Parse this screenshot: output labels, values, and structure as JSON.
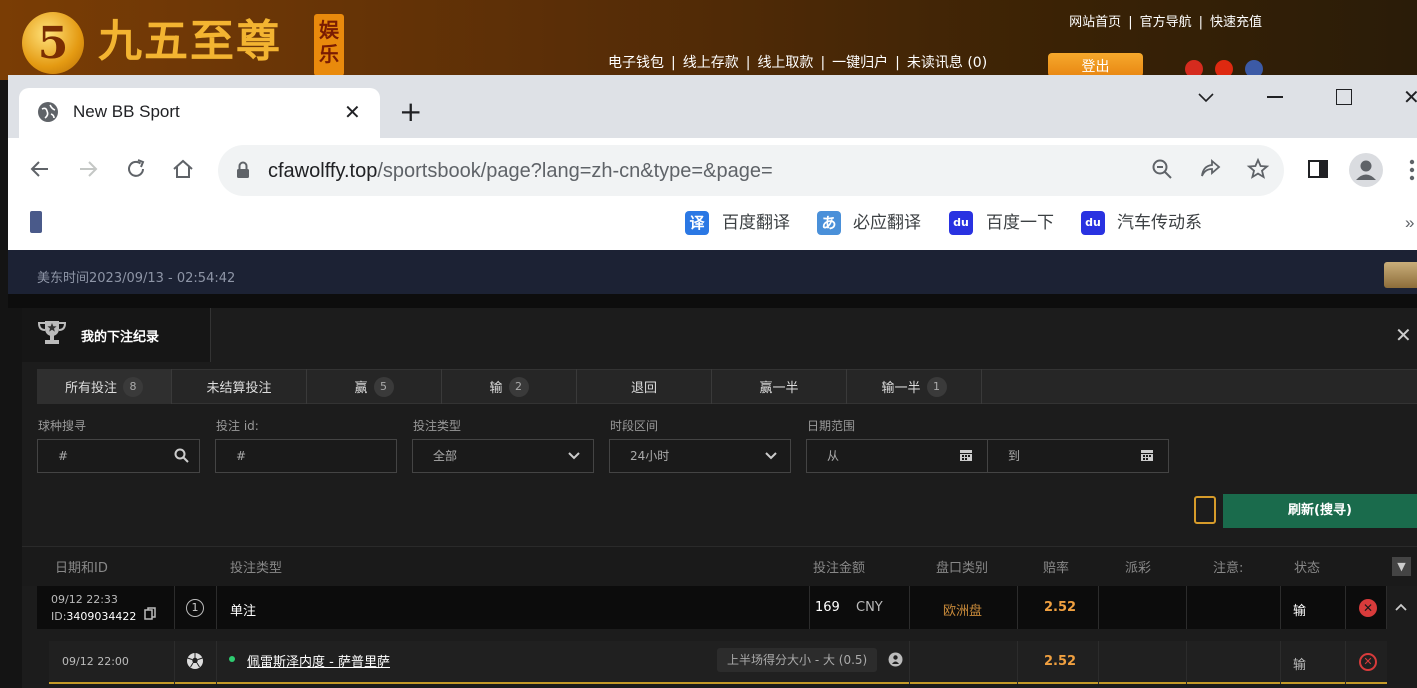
{
  "site": {
    "logo_mark": "5",
    "logo_text": "九五至尊",
    "logo_badge": "娱乐",
    "nav_top": [
      "网站首页",
      "官方导航",
      "快速充值"
    ],
    "nav_main": [
      "电子钱包",
      "线上存款",
      "线上取款",
      "一键归户",
      "未读讯息 (0)"
    ],
    "logout_label": "登出"
  },
  "browser": {
    "tab_title": "New BB Sport",
    "url_domain": "cfawolffy.top",
    "url_path": "/sportsbook/page?lang=zh-cn&type=&page=",
    "bookmarks": [
      {
        "icon": "译",
        "label": "百度翻译",
        "color": "#2b78e4"
      },
      {
        "icon": "あ",
        "label": "必应翻译",
        "color": "#4a90d9"
      },
      {
        "icon": "du",
        "label": "百度一下",
        "color": "#2932e1"
      },
      {
        "icon": "du",
        "label": "汽车传动系",
        "color": "#2932e1"
      }
    ],
    "bookmark_more": "»"
  },
  "sportsbook": {
    "time_label": "美东时间2023/09/13 - 02:54:42",
    "modal_title": "我的下注纪录",
    "tabs": [
      {
        "label": "所有投注",
        "count": "8"
      },
      {
        "label": "未结算投注",
        "count": ""
      },
      {
        "label": "赢",
        "count": "5"
      },
      {
        "label": "输",
        "count": "2"
      },
      {
        "label": "退回",
        "count": ""
      },
      {
        "label": "赢一半",
        "count": ""
      },
      {
        "label": "输一半",
        "count": "1"
      }
    ],
    "filters": {
      "sport_label": "球种搜寻",
      "sport_placeholder": "#",
      "betid_label": "投注 id:",
      "betid_placeholder": "#",
      "bettype_label": "投注类型",
      "bettype_value": "全部",
      "period_label": "时段区间",
      "period_value": "24小时",
      "date_label": "日期范围",
      "date_from": "从",
      "date_to": "到"
    },
    "refresh_label": "刷新(搜寻)",
    "columns": [
      "日期和ID",
      "投注类型",
      "投注金额",
      "盘口类别",
      "赔率",
      "派彩",
      "注意:",
      "状态"
    ],
    "bet": {
      "date": "09/12 22:33",
      "id_prefix": "ID:",
      "id": "3409034422",
      "leg_count": "1",
      "type": "单注",
      "amount": "169",
      "currency": "CNY",
      "market": "欧洲盘",
      "odds": "2.52",
      "status": "输"
    },
    "leg": {
      "date": "09/12 22:00",
      "match": "佩雷斯泽内度 - 萨普里萨",
      "selection": "上半场得分大小 - 大 (0.5)",
      "odds": "2.52",
      "status": "输"
    }
  },
  "colors": {
    "accent_green": "#1a6b4c",
    "odds_orange": "#f0a040",
    "lose_red": "#d83b3b",
    "market_tan": "#c88a3a"
  }
}
